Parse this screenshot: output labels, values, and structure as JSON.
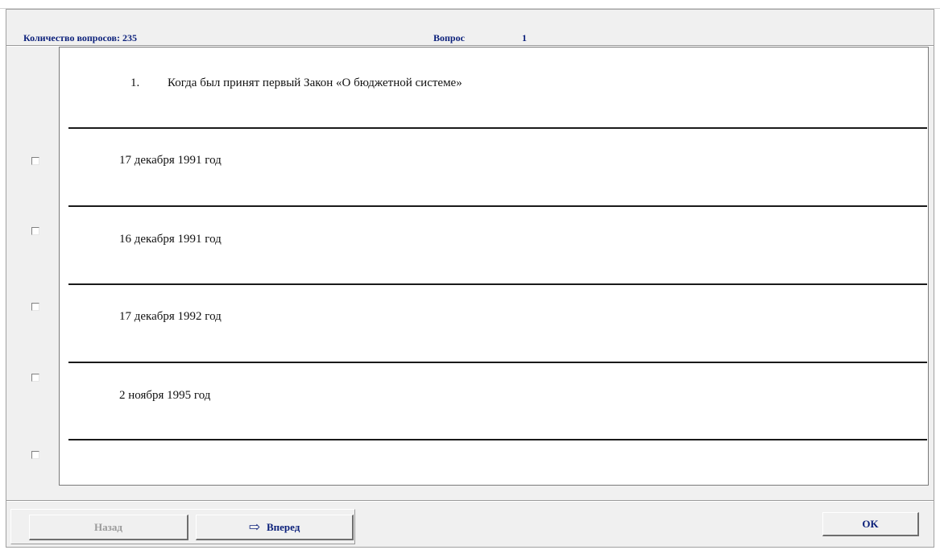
{
  "header": {
    "question_count_label": "Количество вопросов: 235",
    "question_label": "Вопрос",
    "question_number": "1"
  },
  "question": {
    "number": "1.",
    "text": "Когда был принят первый Закон «О бюджетной системе»"
  },
  "answers": [
    {
      "text": "17 декабря 1991 год",
      "checked": false
    },
    {
      "text": "16 декабря 1991 год",
      "checked": false
    },
    {
      "text": "17 декабря 1992 год",
      "checked": false
    },
    {
      "text": "2  ноября 1995 год",
      "checked": false
    },
    {
      "text": "",
      "checked": false
    }
  ],
  "buttons": {
    "back_label": "Назад",
    "next_label": "Вперед",
    "ok_label": "OK"
  },
  "icons": {
    "next_arrow": "right-arrow-icon"
  },
  "colors": {
    "label_blue": "#0a1f7a",
    "disabled_gray": "#9a9a9a",
    "window_bg": "#f0f0f0"
  }
}
